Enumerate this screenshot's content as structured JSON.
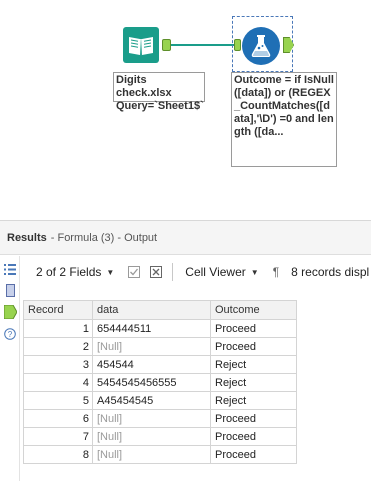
{
  "canvas": {
    "input_tool": {
      "annotation_line1": "Digits check.xlsx",
      "annotation_line2": "Query=`Sheet1$`"
    },
    "formula_tool": {
      "annotation": "Outcome = if IsNull([data]) or (REGEX_CountMatches([data],'\\D') =0 and length ([da..."
    },
    "colors": {
      "input_tool": "#1a9d8a",
      "formula_tool": "#1f6fb5",
      "anchor": "#98d34f"
    }
  },
  "results": {
    "title": "Results",
    "subtitle": "- Formula (3) - Output",
    "toolbar": {
      "fields_label": "2 of 2 Fields",
      "viewer_label": "Cell Viewer",
      "pilcrow": "¶",
      "records_label": "8 records displ"
    },
    "table": {
      "columns": [
        "Record",
        "data",
        "Outcome"
      ],
      "rows": [
        {
          "record": "1",
          "data": "654444511",
          "outcome": "Proceed",
          "null": false
        },
        {
          "record": "2",
          "data": "[Null]",
          "outcome": "Proceed",
          "null": true
        },
        {
          "record": "3",
          "data": "454544",
          "outcome": "Reject",
          "null": false
        },
        {
          "record": "4",
          "data": "5454545456555",
          "outcome": "Reject",
          "null": false
        },
        {
          "record": "5",
          "data": "A45454545",
          "outcome": "Reject",
          "null": false
        },
        {
          "record": "6",
          "data": "[Null]",
          "outcome": "Proceed",
          "null": true
        },
        {
          "record": "7",
          "data": "[Null]",
          "outcome": "Proceed",
          "null": true
        },
        {
          "record": "8",
          "data": "[Null]",
          "outcome": "Proceed",
          "null": true
        }
      ]
    }
  }
}
